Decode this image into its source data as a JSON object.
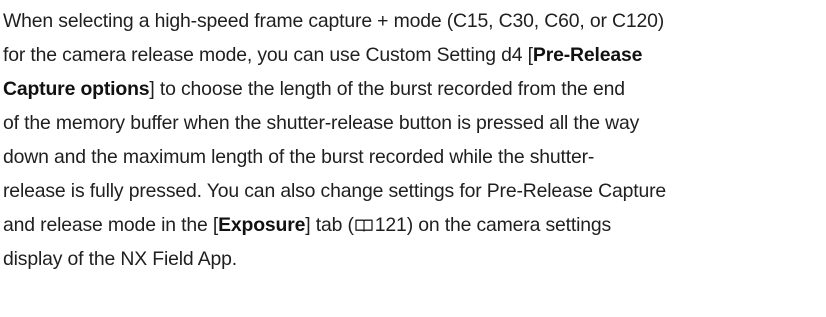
{
  "paragraph": {
    "l1": "When selecting a high-speed frame capture + mode (C15, C30, C60, or C120)",
    "l2_a": "for the camera release mode, you can use Custom Setting d4 [",
    "l2_b": "Pre-Release",
    "l3_a": "Capture options",
    "l3_b": "] to choose the length of the burst recorded from the end",
    "l4": "of the memory buffer when the shutter-release button is pressed all the way",
    "l5": "down and the maximum length of the burst recorded while the shutter-",
    "l6": "release is fully pressed. You can also change settings for Pre-Release Capture",
    "l7_a": "and release mode in the [",
    "l7_b": "Exposure",
    "l7_c": "] tab (",
    "l7_page_ref": "121",
    "l7_d": ") on the camera settings",
    "l8": "display of the NX Field App."
  },
  "icons": {
    "page_reference": "book-icon"
  }
}
